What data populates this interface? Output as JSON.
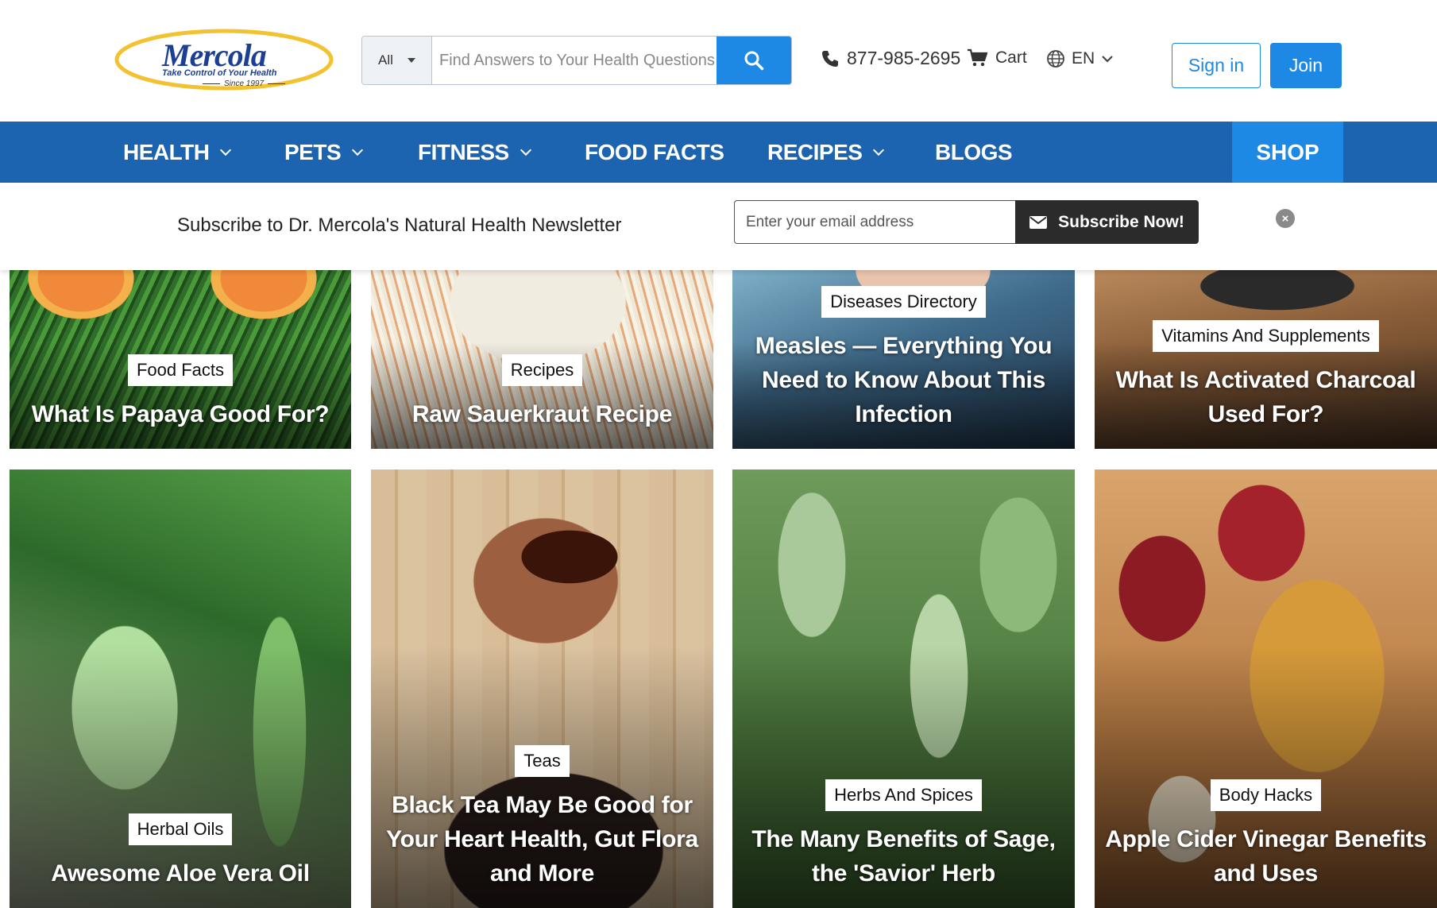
{
  "header": {
    "logo": {
      "brand": "Mercola",
      "tagline": "Take Control of Your Health",
      "since": "Since 1997"
    },
    "search": {
      "scope": "All",
      "placeholder": "Find Answers to Your Health Questions"
    },
    "phone": "877-985-2695",
    "cart_label": "Cart",
    "language": "EN",
    "signin_label": "Sign in",
    "join_label": "Join"
  },
  "nav": {
    "items": [
      {
        "label": "HEALTH"
      },
      {
        "label": "PETS"
      },
      {
        "label": "FITNESS"
      },
      {
        "label": "FOOD FACTS"
      },
      {
        "label": "RECIPES"
      },
      {
        "label": "BLOGS"
      }
    ],
    "shop_label": "SHOP"
  },
  "newsletter": {
    "title": "Subscribe to Dr. Mercola's Natural Health Newsletter",
    "email_placeholder": "Enter your email address",
    "button_label": "Subscribe Now!"
  },
  "cards": [
    {
      "tag": "Food Facts",
      "title": "What Is Papaya Good For?"
    },
    {
      "tag": "Recipes",
      "title": "Raw Sauerkraut Recipe"
    },
    {
      "tag": "Diseases Directory",
      "title": "Measles — Everything You Need to Know About This Infection"
    },
    {
      "tag": "Vitamins And Supplements",
      "title": "What Is Activated Charcoal Used For?"
    },
    {
      "tag": "Herbal Oils",
      "title": "Awesome Aloe Vera Oil"
    },
    {
      "tag": "Teas",
      "title": "Black Tea May Be Good for Your Heart Health, Gut Flora and More"
    },
    {
      "tag": "Herbs And Spices",
      "title": "The Many Benefits of Sage, the 'Savior' Herb"
    },
    {
      "tag": "Body Hacks",
      "title": "Apple Cider Vinegar Benefits and Uses"
    }
  ],
  "colors": {
    "brand_blue": "#1d64b0",
    "accent_blue": "#1e88e5",
    "logo_yellow": "#f2c230"
  }
}
